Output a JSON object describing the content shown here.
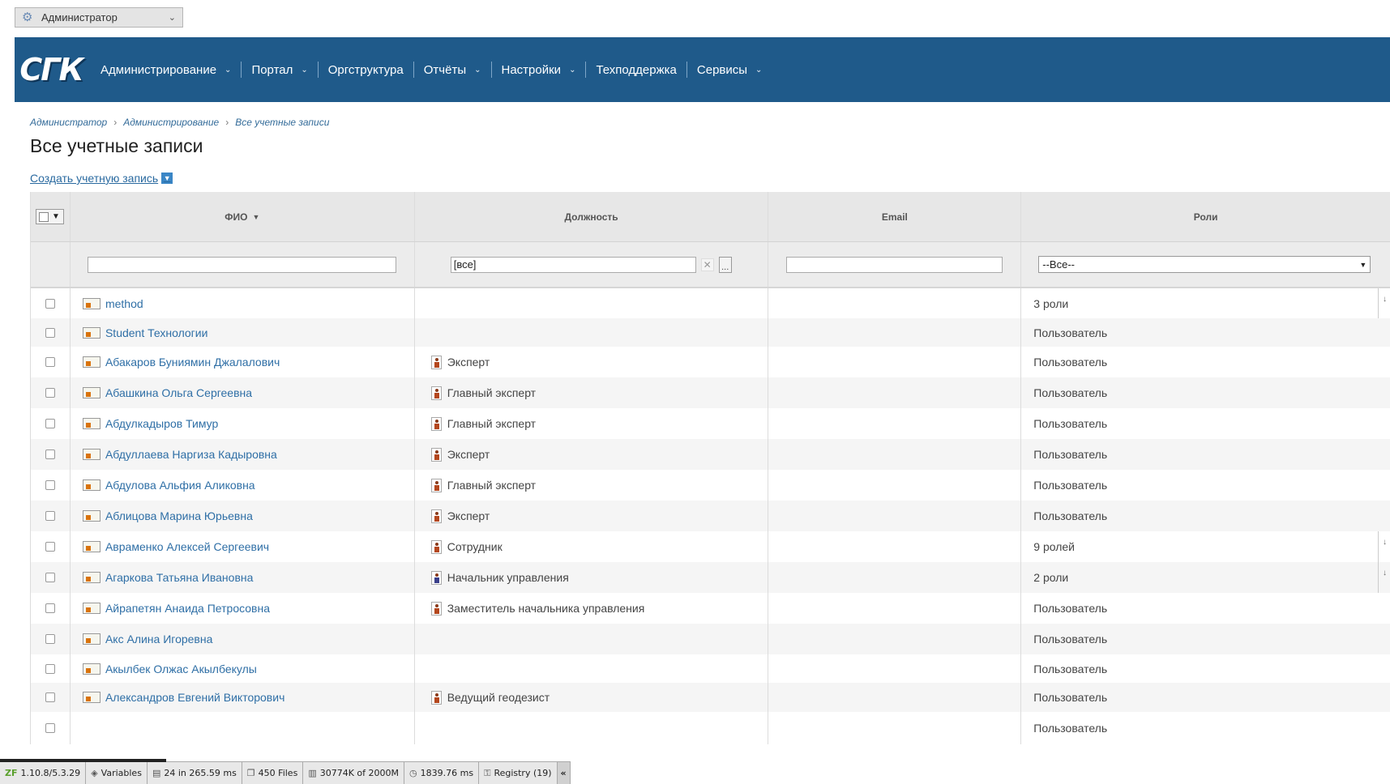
{
  "role_selector": {
    "label": "Администратор"
  },
  "logo": {
    "text": "СГК"
  },
  "nav": [
    {
      "label": "Администрирование",
      "dropdown": true
    },
    {
      "label": "Портал",
      "dropdown": true
    },
    {
      "label": "Оргструктура",
      "dropdown": false
    },
    {
      "label": "Отчёты",
      "dropdown": true
    },
    {
      "label": "Настройки",
      "dropdown": true
    },
    {
      "label": "Техподдержка",
      "dropdown": false
    },
    {
      "label": "Сервисы",
      "dropdown": true
    }
  ],
  "breadcrumb": [
    "Администратор",
    "Администрирование",
    "Все учетные записи"
  ],
  "page_title": "Все учетные записи",
  "create_link": "Создать учетную запись",
  "table": {
    "columns": {
      "fio": "ФИО",
      "position": "Должность",
      "email": "Email",
      "roles": "Роли"
    },
    "filters": {
      "fio": "",
      "position": "[все]",
      "email": "",
      "roles": "--Все--"
    },
    "rows": [
      {
        "name": "method",
        "position": "",
        "boss": false,
        "email": "",
        "roles": "3 роли",
        "more": true
      },
      {
        "name": "Student Технологии",
        "position": "",
        "boss": false,
        "email": "",
        "roles": "Пользователь",
        "more": false
      },
      {
        "name": "Абакаров Буниямин Джалалович",
        "position": "Эксперт",
        "boss": false,
        "email": "",
        "roles": "Пользователь",
        "more": false
      },
      {
        "name": "Абашкина Ольга Сергеевна",
        "position": "Главный эксперт",
        "boss": false,
        "email": "",
        "roles": "Пользователь",
        "more": false
      },
      {
        "name": "Абдулкадыров Тимур",
        "position": "Главный эксперт",
        "boss": false,
        "email": "",
        "roles": "Пользователь",
        "more": false
      },
      {
        "name": "Абдуллаева Наргиза Кадыровна",
        "position": "Эксперт",
        "boss": false,
        "email": "",
        "roles": "Пользователь",
        "more": false
      },
      {
        "name": "Абдулова Альфия Аликовна",
        "position": "Главный эксперт",
        "boss": false,
        "email": "",
        "roles": "Пользователь",
        "more": false
      },
      {
        "name": "Аблицова Марина Юрьевна",
        "position": "Эксперт",
        "boss": false,
        "email": "",
        "roles": "Пользователь",
        "more": false
      },
      {
        "name": "Авраменко Алексей Сергеевич",
        "position": "Сотрудник",
        "boss": false,
        "email": "",
        "roles": "9 ролей",
        "more": true
      },
      {
        "name": "Агаркова Татьяна Ивановна",
        "position": "Начальник управления",
        "boss": true,
        "email": "",
        "roles": "2 роли",
        "more": true
      },
      {
        "name": "Айрапетян Анаида Петросовна",
        "position": "Заместитель начальника управления",
        "boss": false,
        "email": "",
        "roles": "Пользователь",
        "more": false
      },
      {
        "name": "Акс Алина Игоревна",
        "position": "",
        "boss": false,
        "email": "",
        "roles": "Пользователь",
        "more": false
      },
      {
        "name": "Акылбек Олжас Акылбекулы",
        "position": "",
        "boss": false,
        "email": "",
        "roles": "Пользователь",
        "more": false
      },
      {
        "name": "Александров Евгений Викторович",
        "position": "Ведущий геодезист",
        "boss": false,
        "email": "",
        "roles": "Пользователь",
        "more": false
      },
      {
        "name": "",
        "position": "",
        "boss": false,
        "email": "",
        "roles": "Пользователь",
        "more": false
      }
    ]
  },
  "debug_bar": [
    {
      "icon": "zf-icon",
      "text": "1.10.8/5.3.29"
    },
    {
      "icon": "variables-icon",
      "text": "Variables"
    },
    {
      "icon": "database-icon",
      "text": "24 in 265.59 ms"
    },
    {
      "icon": "files-icon",
      "text": "450 Files"
    },
    {
      "icon": "memory-icon",
      "text": "30774K of 2000M"
    },
    {
      "icon": "clock-icon",
      "text": "1839.76 ms"
    },
    {
      "icon": "key-icon",
      "text": "Registry (19)"
    }
  ],
  "colors": {
    "header": "#1f5a8a",
    "link": "#2f6fa6",
    "row_alt": "#f5f5f5"
  }
}
